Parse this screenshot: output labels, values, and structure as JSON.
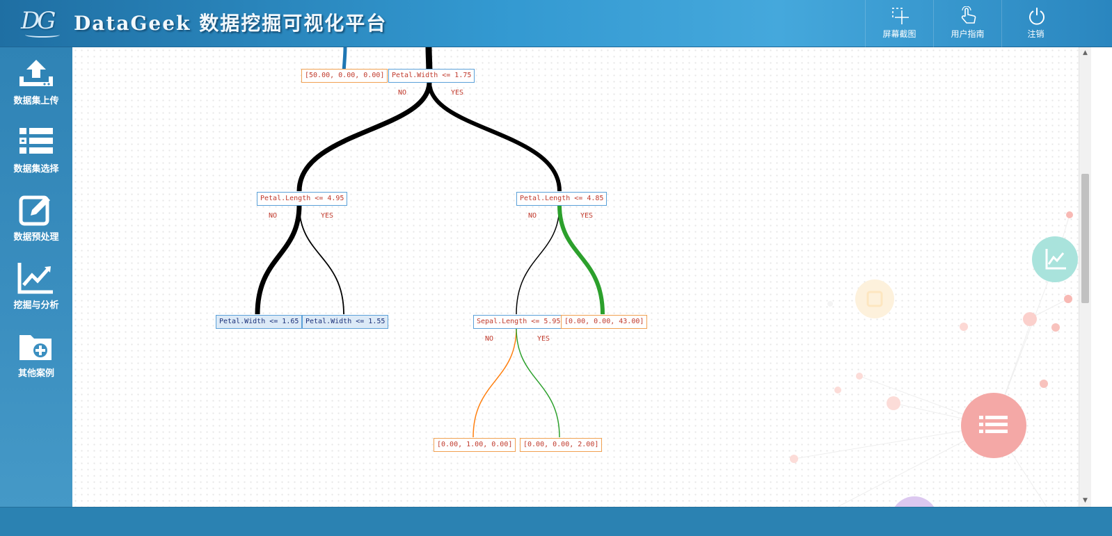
{
  "header": {
    "logo": "DG",
    "title": "DataGeek 数据挖掘可视化平台",
    "actions": [
      {
        "label": "屏幕截图",
        "icon": "screenshot-icon"
      },
      {
        "label": "用户指南",
        "icon": "hand-pointer-icon"
      },
      {
        "label": "注销",
        "icon": "power-icon"
      }
    ]
  },
  "sidebar": {
    "items": [
      {
        "label": "数据集上传",
        "icon": "upload-icon"
      },
      {
        "label": "数据集选择",
        "icon": "list-icon"
      },
      {
        "label": "数据预处理",
        "icon": "edit-icon"
      },
      {
        "label": "挖掘与分析",
        "icon": "line-chart-icon"
      },
      {
        "label": "其他案例",
        "icon": "folder-add-icon"
      }
    ]
  },
  "tree": {
    "root": {
      "label": "Petal.Width <= 1.75",
      "no": "NO",
      "yes": "YES"
    },
    "leaf_setosa": "[50.00, 0.00, 0.00]",
    "left": {
      "label": "Petal.Length <= 4.95",
      "no": "NO",
      "yes": "YES"
    },
    "right": {
      "label": "Petal.Length <= 4.85",
      "no": "NO",
      "yes": "YES"
    },
    "left_left": "Petal.Width <= 1.65",
    "left_right": "Petal.Width <= 1.55",
    "right_left": {
      "label": "Sepal.Length <= 5.95",
      "no": "NO",
      "yes": "YES"
    },
    "right_right": "[0.00, 0.00, 43.00]",
    "rl_left": "[0.00, 1.00, 0.00]",
    "rl_right": "[0.00, 0.00, 2.00]"
  },
  "colors": {
    "edge_main": "#000000",
    "edge_setosa": "#1f77b4",
    "edge_orange": "#ff7f0e",
    "edge_green": "#2ca02c",
    "node_border": "#5aa0d8",
    "leaf_border": "#f0a050",
    "node_text": "#c0392b",
    "header_bg": "#3399d1",
    "sidebar_bg": "#3b8fc0"
  }
}
